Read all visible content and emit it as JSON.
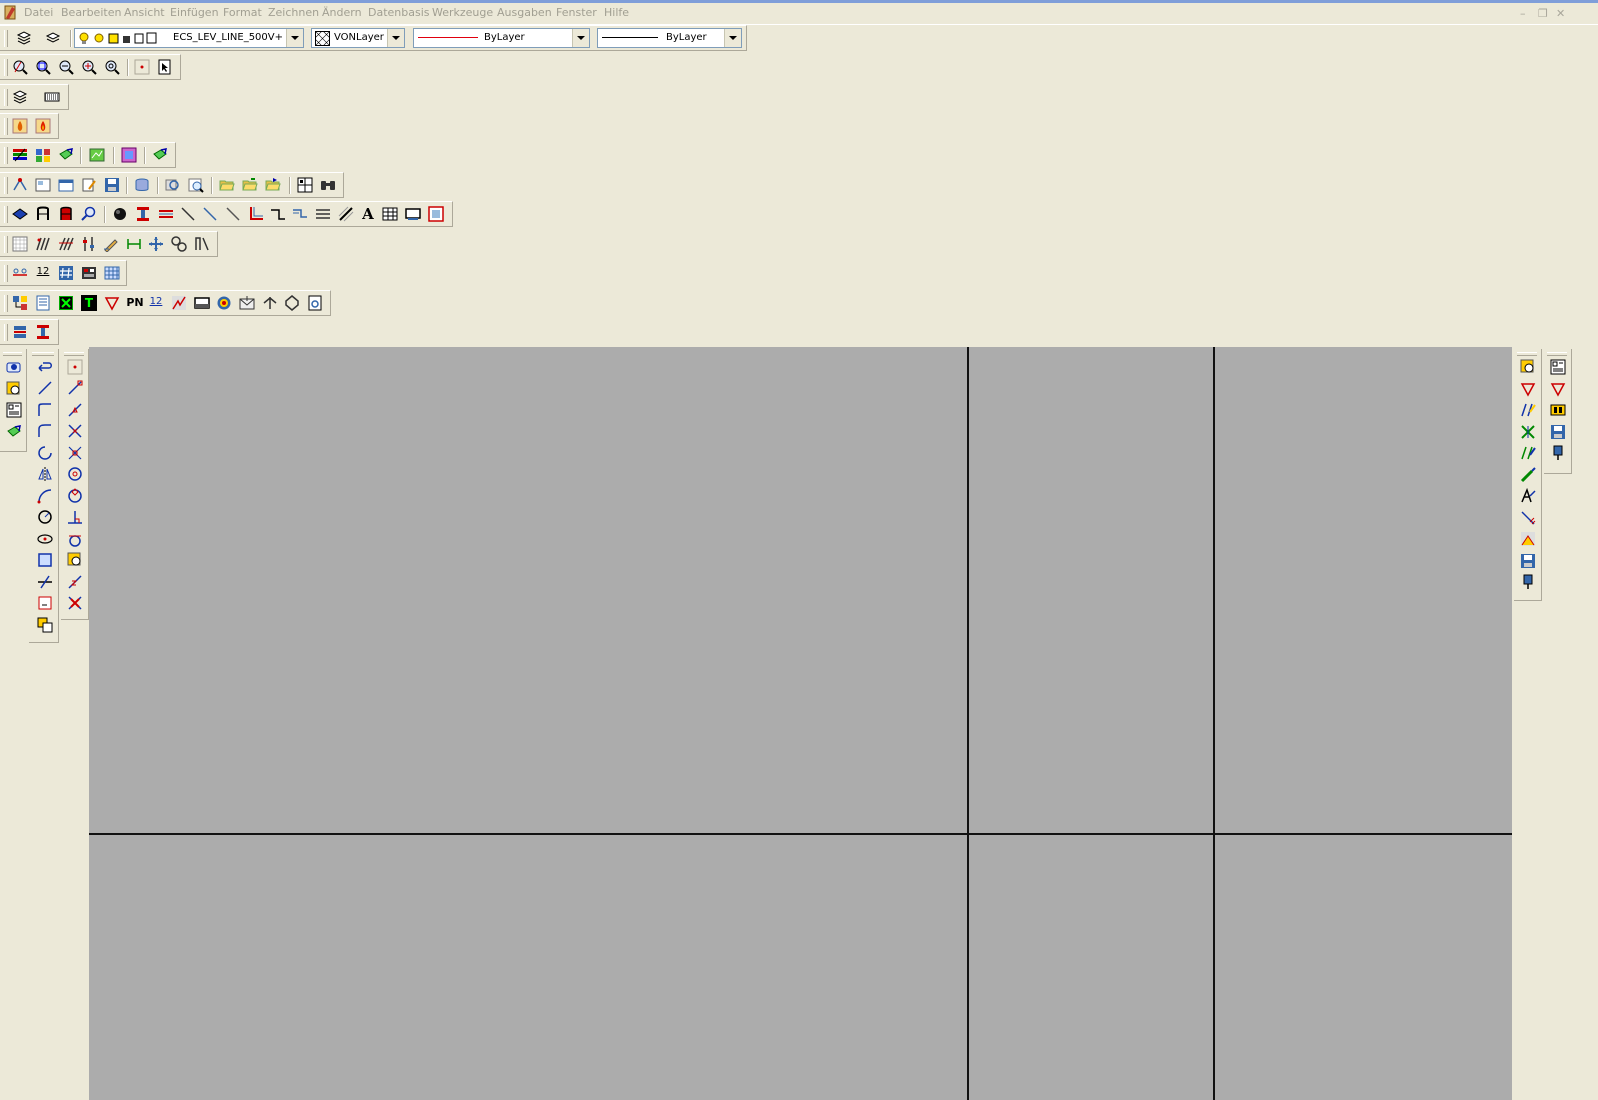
{
  "menubar": {
    "items": [
      "Datei",
      "Bearbeiten",
      "Ansicht",
      "Einfügen",
      "Format",
      "Zeichnen",
      "Ändern",
      "Datenbasis",
      "Werkzeuge",
      "Ausgaben",
      "Fenster",
      "Hilfe"
    ],
    "window_controls": [
      "–",
      "❐",
      "✕"
    ]
  },
  "properties": {
    "layer": "ECS_LEV_LINE_500V+",
    "color": "VONLayer",
    "linetype": "ByLayer",
    "lineweight": "ByLayer"
  },
  "toolbars": {
    "text_labels": {
      "A": "A",
      "PN": "PN",
      "twelve": "12",
      "T": "T"
    }
  },
  "colors": {
    "background": "#ece9d8",
    "canvas": "#acacac",
    "linetype_sample": "#e0000e",
    "menu_disabled": "#a19f92"
  }
}
